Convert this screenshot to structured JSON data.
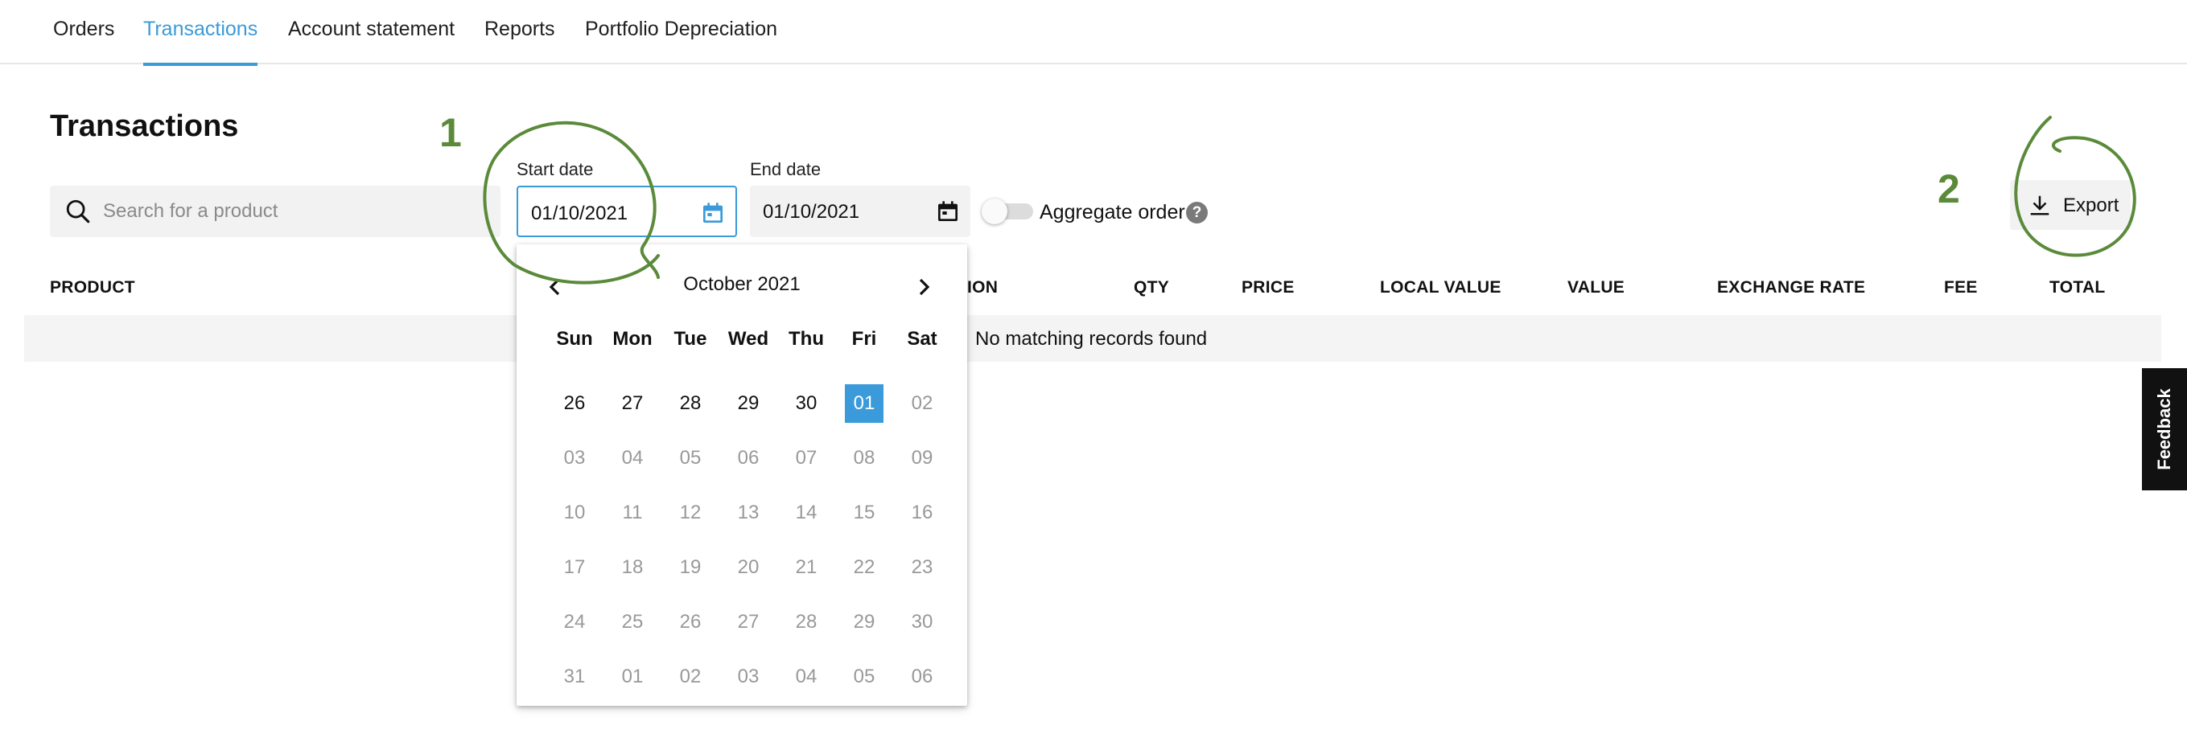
{
  "nav": {
    "tabs": [
      {
        "label": "Orders"
      },
      {
        "label": "Transactions"
      },
      {
        "label": "Account statement"
      },
      {
        "label": "Reports"
      },
      {
        "label": "Portfolio Depreciation"
      }
    ],
    "active_index": 1
  },
  "page": {
    "title": "Transactions"
  },
  "search": {
    "placeholder": "Search for a product",
    "value": ""
  },
  "start_date": {
    "label": "Start date",
    "value": "01/10/2021"
  },
  "end_date": {
    "label": "End date",
    "value": "01/10/2021"
  },
  "aggregate": {
    "label": "Aggregate order",
    "checked": false,
    "help": "?"
  },
  "export": {
    "label": "Export"
  },
  "table": {
    "columns": [
      "PRODUCT",
      "ION",
      "QTY",
      "PRICE",
      "LOCAL VALUE",
      "VALUE",
      "EXCHANGE RATE",
      "FEE",
      "TOTAL"
    ],
    "empty_message": "No matching records found"
  },
  "calendar": {
    "month_label": "October 2021",
    "weekdays": [
      "Sun",
      "Mon",
      "Tue",
      "Wed",
      "Thu",
      "Fri",
      "Sat"
    ],
    "weeks": [
      [
        "26",
        "27",
        "28",
        "29",
        "30",
        "01",
        "02"
      ],
      [
        "03",
        "04",
        "05",
        "06",
        "07",
        "08",
        "09"
      ],
      [
        "10",
        "11",
        "12",
        "13",
        "14",
        "15",
        "16"
      ],
      [
        "17",
        "18",
        "19",
        "20",
        "21",
        "22",
        "23"
      ],
      [
        "24",
        "25",
        "26",
        "27",
        "28",
        "29",
        "30"
      ],
      [
        "31",
        "01",
        "02",
        "03",
        "04",
        "05",
        "06"
      ]
    ],
    "selected": "01"
  },
  "feedback": {
    "label": "Feedback"
  },
  "annotations": {
    "step1": "1",
    "step2": "2",
    "color": "#5a8a3a"
  },
  "colors": {
    "accent": "#3b9ad9",
    "annotation": "#5a8a3a"
  }
}
